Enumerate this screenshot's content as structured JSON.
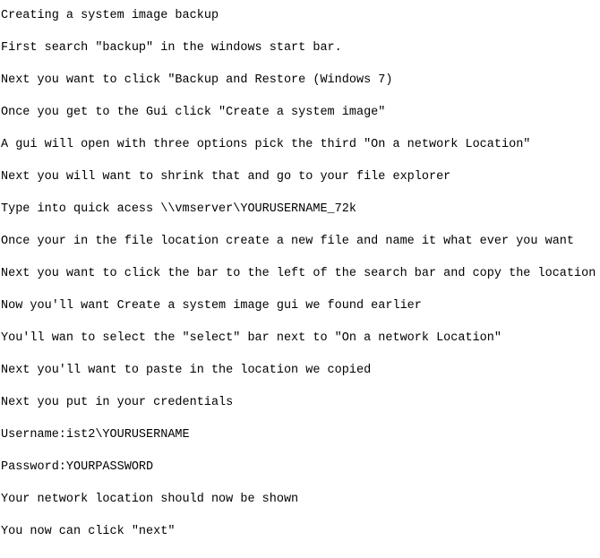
{
  "document": {
    "lines": [
      "Creating a system image backup",
      "First search \"backup\" in the windows start bar.",
      "Next you want to click \"Backup and Restore (Windows 7)",
      "Once you get to the Gui click \"Create a system image\"",
      "A gui will open with three options pick the third \"On a network Location\"",
      "Next you will want to shrink that and go to your file explorer",
      "Type into quick acess \\\\vmserver\\YOURUSERNAME_72k",
      "Once your in the file location create a new file and name it what ever you want",
      "Next you want to click the bar to the left of the search bar and copy the location",
      "Now you'll want Create a system image gui we found earlier",
      "You'll wan to select the \"select\" bar next to \"On a network Location\"",
      "Next you'll want to paste in the location we copied",
      "Next you put in your credentials",
      "Username:ist2\\YOURUSERNAME",
      "Password:YOURPASSWORD",
      "Your network location should now be shown",
      "You now can click \"next\""
    ]
  }
}
